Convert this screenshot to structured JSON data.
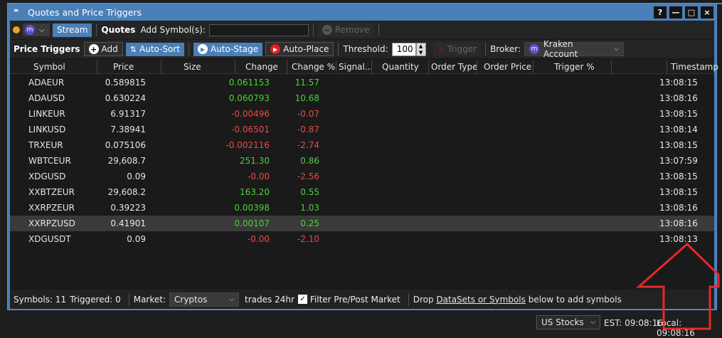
{
  "window": {
    "title": "Quotes and Price Triggers",
    "btn_help": "?",
    "btn_min": "—",
    "btn_max": "□",
    "btn_close": "×"
  },
  "toolbar": {
    "stream": "Stream",
    "quotes": "Quotes",
    "add_symbols": "Add Symbol(s):",
    "remove": "Remove",
    "price_triggers": "Price Triggers",
    "add": "Add",
    "auto_sort": "Auto-Sort",
    "auto_stage": "Auto-Stage",
    "auto_place": "Auto-Place",
    "threshold": "Threshold:",
    "threshold_value": "100",
    "trigger": "Trigger",
    "broker": "Broker:",
    "broker_value": "Kraken Account"
  },
  "columns": [
    "Symbol",
    "Price",
    "Size",
    "Change",
    "Change %",
    "Signal...",
    "Quantity",
    "Order Type",
    "Order Price",
    "Trigger %",
    "Timestamp"
  ],
  "rows": [
    {
      "symbol": "ADAEUR",
      "price": "0.589815",
      "change": "0.061153",
      "change_pct": "11.57",
      "ts": "13:08:15",
      "dir": "pos"
    },
    {
      "symbol": "ADAUSD",
      "price": "0.630224",
      "change": "0.060793",
      "change_pct": "10.68",
      "ts": "13:08:16",
      "dir": "pos"
    },
    {
      "symbol": "LINKEUR",
      "price": "6.91317",
      "change": "-0.00496",
      "change_pct": "-0.07",
      "ts": "13:08:15",
      "dir": "neg"
    },
    {
      "symbol": "LINKUSD",
      "price": "7.38941",
      "change": "-0.06501",
      "change_pct": "-0.87",
      "ts": "13:08:14",
      "dir": "neg"
    },
    {
      "symbol": "TRXEUR",
      "price": "0.075106",
      "change": "-0.002116",
      "change_pct": "-2.74",
      "ts": "13:08:15",
      "dir": "neg"
    },
    {
      "symbol": "WBTCEUR",
      "price": "29,608.7",
      "change": "251.30",
      "change_pct": "0.86",
      "ts": "13:07:59",
      "dir": "pos"
    },
    {
      "symbol": "XDGUSD",
      "price": "0.09",
      "change": "-0.00",
      "change_pct": "-2.56",
      "ts": "13:08:15",
      "dir": "neg"
    },
    {
      "symbol": "XXBTZEUR",
      "price": "29,608.2",
      "change": "163.20",
      "change_pct": "0.55",
      "ts": "13:08:15",
      "dir": "pos"
    },
    {
      "symbol": "XXRPZEUR",
      "price": "0.39223",
      "change": "0.00398",
      "change_pct": "1.03",
      "ts": "13:08:16",
      "dir": "pos"
    },
    {
      "symbol": "XXRPZUSD",
      "price": "0.41901",
      "change": "0.00107",
      "change_pct": "0.25",
      "ts": "13:08:16",
      "dir": "pos",
      "selected": true
    },
    {
      "symbol": "XDGUSDT",
      "price": "0.09",
      "change": "-0.00",
      "change_pct": "-2.10",
      "ts": "13:08:13",
      "dir": "neg"
    }
  ],
  "status": {
    "symbols": "Symbols: 11",
    "triggered": "Triggered: 0",
    "market": "Market:",
    "market_value": "Cryptos",
    "trades": "trades 24hr",
    "filter": "Filter Pre/Post Market",
    "drop_pre": "Drop ",
    "drop_link": "DataSets or Symbols",
    "drop_post": " below to add symbols"
  },
  "taskbar": {
    "market": "US Stocks",
    "est": "EST: 09:08:16",
    "local": "Local: 09:08:16"
  },
  "colors": {
    "accent": "#4a7fb8",
    "positive": "#4cd137",
    "negative": "#e84a4a",
    "annotation": "#e8282b"
  }
}
